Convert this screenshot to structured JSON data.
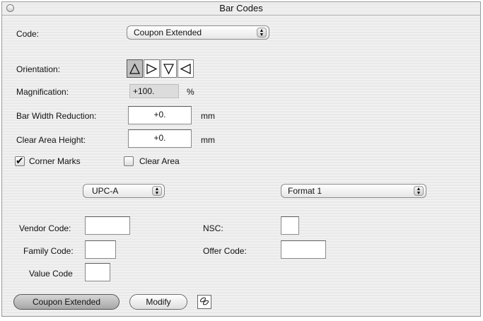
{
  "window": {
    "title": "Bar Codes"
  },
  "code": {
    "label": "Code:",
    "value": "Coupon Extended"
  },
  "orientation": {
    "label": "Orientation:",
    "buttons": [
      "up",
      "right",
      "down",
      "left"
    ],
    "selected": "up"
  },
  "magnification": {
    "label": "Magnification:",
    "value": "+100.",
    "unit": "%"
  },
  "bar_width_reduction": {
    "label": "Bar Width Reduction:",
    "value": "+0.",
    "unit": "mm"
  },
  "clear_area_height": {
    "label": "Clear Area Height:",
    "value": "+0.",
    "unit": "mm"
  },
  "corner_marks": {
    "label": "Corner Marks",
    "checked": true
  },
  "clear_area": {
    "label": "Clear Area",
    "checked": false
  },
  "symbology": {
    "value": "UPC-A"
  },
  "format": {
    "value": "Format 1"
  },
  "vendor_code": {
    "label": "Vendor Code:",
    "value": ""
  },
  "family_code": {
    "label": "Family Code:",
    "value": ""
  },
  "value_code": {
    "label": "Value Code",
    "value": ""
  },
  "nsc": {
    "label": "NSC:",
    "value": ""
  },
  "offer_code": {
    "label": "Offer Code:",
    "value": ""
  },
  "buttons": {
    "coupon_extended": "Coupon Extended",
    "modify": "Modify"
  }
}
